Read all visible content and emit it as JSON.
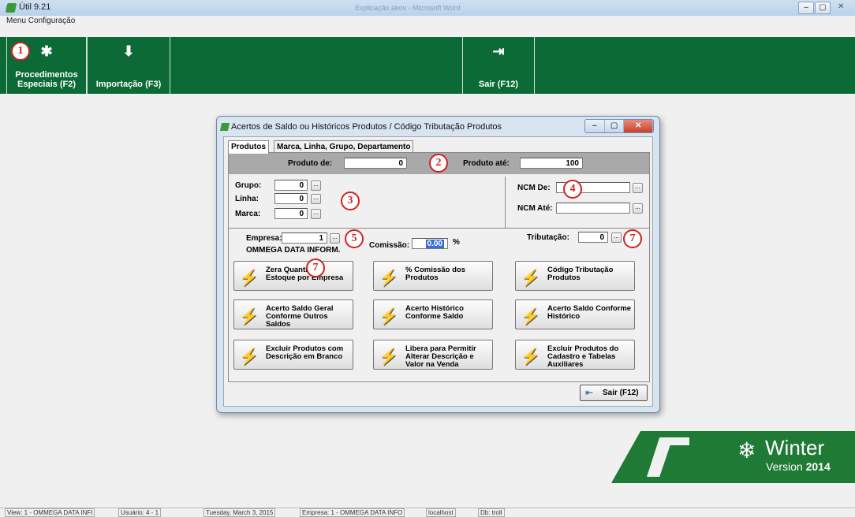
{
  "window": {
    "title": "Útil 9.21",
    "blurred_title": "Explicação akov - Microsoft Word"
  },
  "menu": {
    "label": "Menu Configuração"
  },
  "toolbar": [
    {
      "label_1": "Procedimentos",
      "label_2": "Especiais (F2)",
      "icon": "gear-icon",
      "glyph": "✱"
    },
    {
      "label_1": "Importação (F3)",
      "icon": "arrow-down-icon",
      "glyph": "🡇"
    },
    {
      "label_1": "Sair (F12)",
      "icon": "exit-icon",
      "glyph": "➜"
    }
  ],
  "markers": [
    "1",
    "2",
    "3",
    "4",
    "5",
    "7",
    "7"
  ],
  "dialog": {
    "title": "Acertos de Saldo ou Históricos Produtos / Código Tributação Produtos",
    "tabs": [
      "Produtos",
      "Marca, Linha, Grupo, Departamento"
    ],
    "produto_de_label": "Produto de:",
    "produto_de_value": "0",
    "produto_ate_label": "Produto até:",
    "produto_ate_value": "100",
    "grupo_label": "Grupo:",
    "grupo_value": "0",
    "linha_label": "Linha:",
    "linha_value": "0",
    "marca_label": "Marca:",
    "marca_value": "0",
    "ncm_de_label": "NCM De:",
    "ncm_de_value": "",
    "ncm_ate_label": "NCM Até:",
    "ncm_ate_value": "",
    "empresa_label": "Empresa:",
    "empresa_value": "1",
    "empresa_name": "OMMEGA DATA INFORM.",
    "comissao_label": "Comissão:",
    "comissao_value": "0.00",
    "comissao_unit": "%",
    "tributacao_label": "Tributação:",
    "tributacao_value": "0",
    "buttons": [
      "Zera Quantidade Estoque por Empresa",
      "% Comissão dos Produtos",
      "Código Tributação Produtos",
      "Acerto Saldo Geral Conforme Outros Saldos",
      "Acerto Histórico Conforme Saldo",
      "Acerto Saldo Conforme Histórico",
      "Excluir Produtos com Descrição em Branco",
      "Libera para Permitir Alterar Descrição e Valor na Venda",
      "Excluir Produtos do Cadastro e Tabelas Auxiliares"
    ],
    "exit_label": "Sair (F12)"
  },
  "branding": {
    "word": "Winter",
    "version_prefix": "Version",
    "version_year": "2014"
  },
  "status": [
    "View: 1 - OMMEGA DATA INFI",
    "Usuário: 4 - 1",
    "Tuesday, March 3, 2015",
    "Empresa: 1 - OMMEGA DATA INFO",
    "localhost",
    "Db: troll"
  ],
  "colors": {
    "toolbar": "#0b6a35",
    "marker": "#d12222",
    "accent_blue": "#3a6fd8"
  }
}
